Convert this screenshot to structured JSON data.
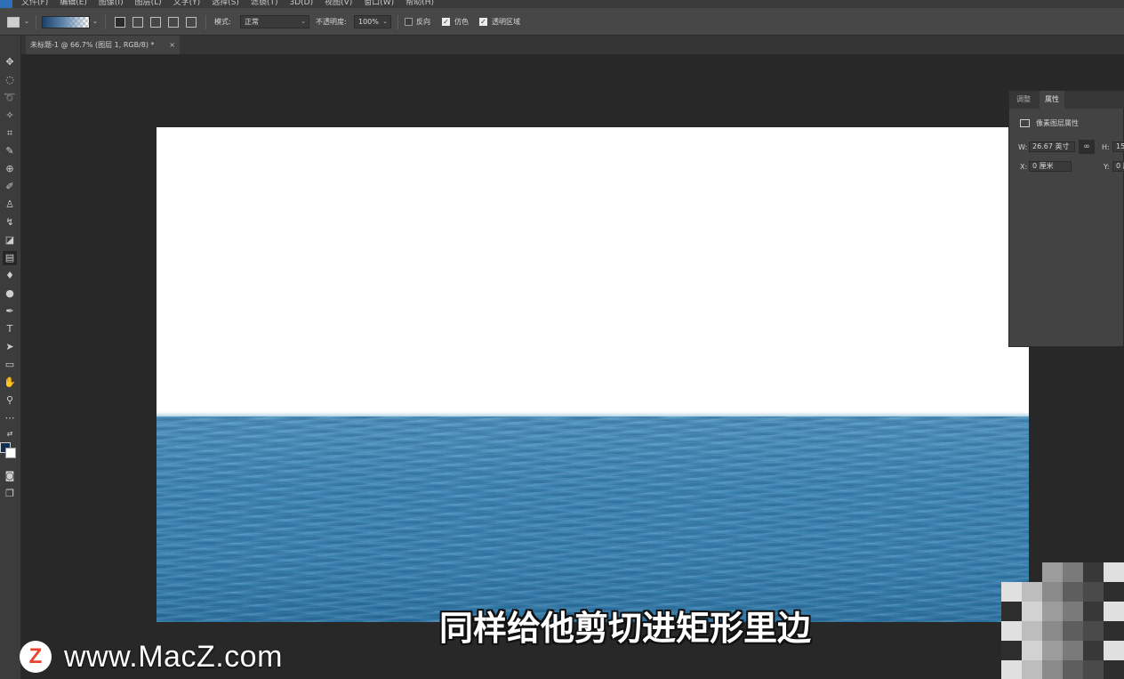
{
  "menu": [
    "文件(F)",
    "编辑(E)",
    "图像(I)",
    "图层(L)",
    "文字(Y)",
    "选择(S)",
    "滤镜(T)",
    "3D(D)",
    "视图(V)",
    "窗口(W)",
    "帮助(H)"
  ],
  "options": {
    "mode_label": "模式:",
    "mode_value": "正常",
    "opacity_label": "不透明度:",
    "opacity_value": "100%",
    "reverse_label": "反向",
    "dither_label": "仿色",
    "transparency_label": "透明区域",
    "reverse_checked": false,
    "dither_checked": true,
    "transparency_checked": true
  },
  "document_tab": {
    "title": "未标题-1 @ 66.7% (图层 1, RGB/8) *",
    "close": "×"
  },
  "properties": {
    "tab_adjust": "调整",
    "tab_properties": "属性",
    "section_title": "像素图层属性",
    "w_label": "W:",
    "w_value": "26.67 英寸",
    "link": "∞",
    "h_label": "H:",
    "h_value": "15",
    "x_label": "X:",
    "x_value": "0 厘米",
    "y_label": "Y:",
    "y_value": "0 厘"
  },
  "colors": {
    "foreground": "#0e2f4f",
    "background": "#ffffff",
    "sea": "#3a82b1"
  },
  "subtitle": "同样给他剪切进矩形里边",
  "watermark": {
    "logo_letter": "Z",
    "text": "www.MacZ.com"
  }
}
